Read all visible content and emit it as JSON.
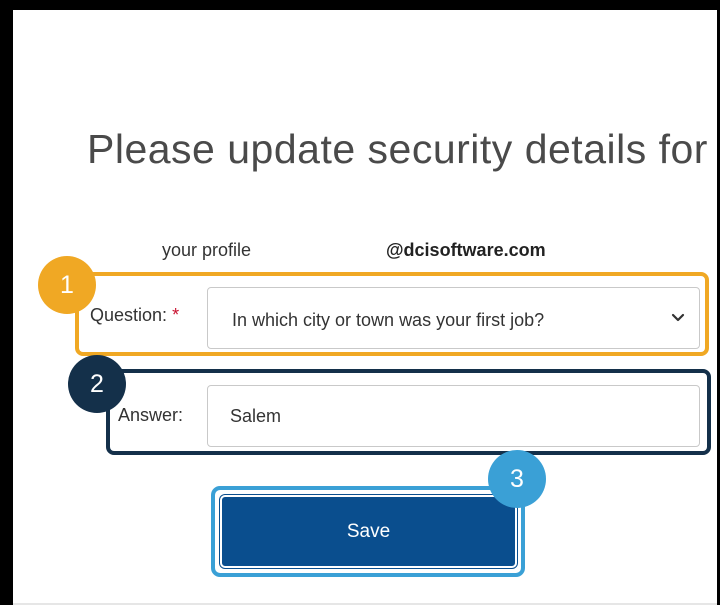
{
  "heading": "Please update security details for",
  "profile": {
    "label": "your profile",
    "domain": "@dcisoftware.com"
  },
  "question": {
    "label": "Question:",
    "required_marker": "*",
    "selected": "In which city or town was your first job?"
  },
  "answer": {
    "label": "Answer:",
    "value": "Salem"
  },
  "save_label": "Save",
  "callouts": {
    "step1": "1",
    "step2": "2",
    "step3": "3"
  },
  "icons": {
    "dropdown": "chevron-down-icon"
  },
  "colors": {
    "callout_1": "#f0a824",
    "callout_2": "#14304a",
    "callout_3": "#3aa0d6",
    "button_bg": "#0a4e8e",
    "required": "#c8102e"
  }
}
